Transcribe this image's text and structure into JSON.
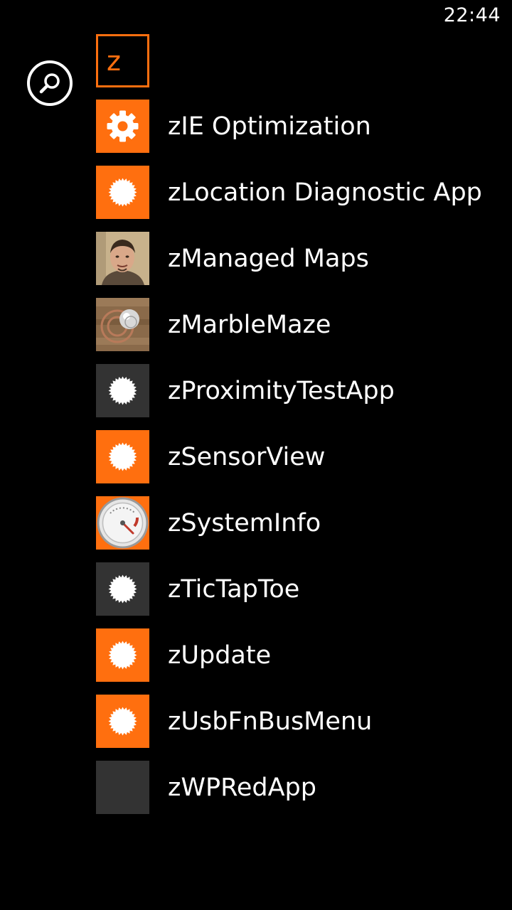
{
  "status_bar": {
    "time": "22:44"
  },
  "search": {
    "icon": "search-icon"
  },
  "letter_tile": {
    "letter": "z"
  },
  "colors": {
    "accent": "#ff6f0f",
    "tile_dark": "#333333",
    "background": "#000000"
  },
  "apps": [
    {
      "name": "zIE Optimization",
      "icon": "gear-icon",
      "tile": "orange"
    },
    {
      "name": "zLocation Diagnostic App",
      "icon": "sunburst-icon",
      "tile": "orange"
    },
    {
      "name": "zManaged Maps",
      "icon": "person-photo-icon",
      "tile": "photo"
    },
    {
      "name": "zMarbleMaze",
      "icon": "marble-icon",
      "tile": "photo"
    },
    {
      "name": "zProximityTestApp",
      "icon": "sunburst-icon",
      "tile": "dark"
    },
    {
      "name": "zSensorView",
      "icon": "sunburst-icon",
      "tile": "orange"
    },
    {
      "name": "zSystemInfo",
      "icon": "gauge-icon",
      "tile": "orange"
    },
    {
      "name": "zTicTapToe",
      "icon": "sunburst-icon",
      "tile": "dark"
    },
    {
      "name": "zUpdate",
      "icon": "sunburst-icon",
      "tile": "orange"
    },
    {
      "name": "zUsbFnBusMenu",
      "icon": "sunburst-icon",
      "tile": "orange"
    },
    {
      "name": "zWPRedApp",
      "icon": "blank-tile-icon",
      "tile": "dark"
    }
  ]
}
